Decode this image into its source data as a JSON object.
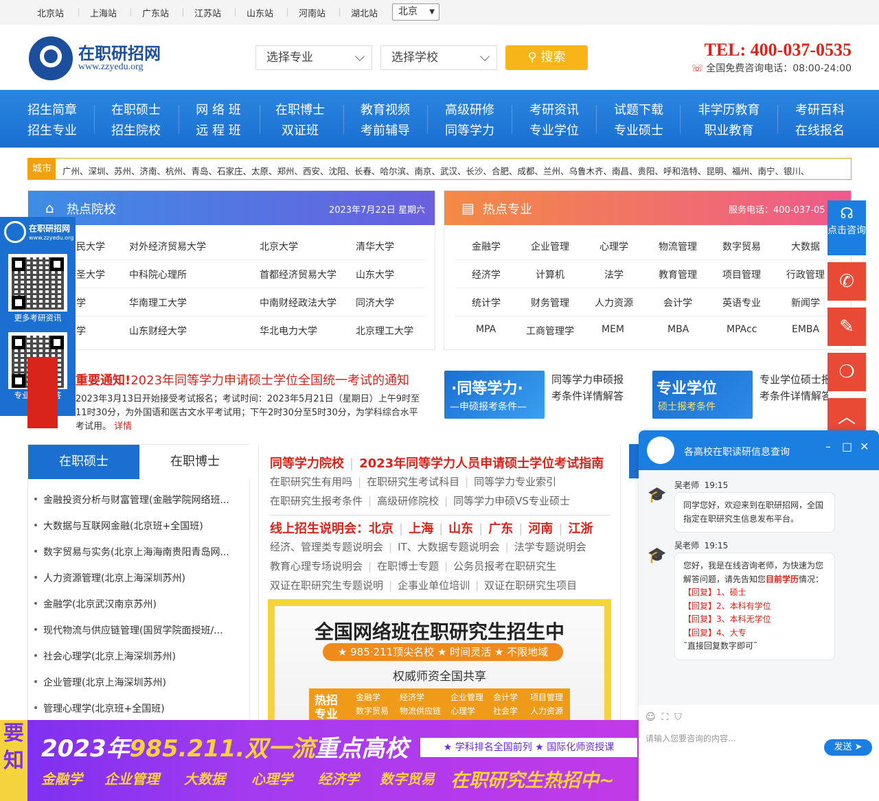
{
  "stations": [
    "北京站",
    "上海站",
    "广东站",
    "江苏站",
    "山东站",
    "河南站",
    "湖北站"
  ],
  "city_select": "北京",
  "logo": {
    "cn": "在职研招网",
    "en": "www.zzyedu.org"
  },
  "search": {
    "major": "选择专业",
    "school": "选择学校",
    "button": "搜索"
  },
  "contact": {
    "tel": "TEL: 400-037-0535",
    "hotline": "全国免费咨询电话：08:00-24:00"
  },
  "nav": [
    [
      "招生简章",
      "招生专业"
    ],
    [
      "在职硕士",
      "招生院校"
    ],
    [
      "网 络 班",
      "远 程 班"
    ],
    [
      "在职博士",
      "双证班"
    ],
    [
      "教育视频",
      "考前辅导"
    ],
    [
      "高级研修",
      "同等学力"
    ],
    [
      "考研资讯",
      "专业学位"
    ],
    [
      "试题下载",
      "专业硕士"
    ],
    [
      "非学历教育",
      "职业教育"
    ],
    [
      "考研百科",
      "在线报名"
    ]
  ],
  "cities": {
    "label": "城市",
    "list": "广州、深圳、苏州、济南、杭州、青岛、石家庄、太原、郑州、西安、沈阳、长春、哈尔滨、南京、武汉、长沙、合肥、成都、兰州、乌鲁木齐、南昌、贵阳、呼和浩特、昆明、福州、南宁、银川、"
  },
  "hot_schools": {
    "title": "热点院校",
    "date": "2023年7月22日 星期六",
    "rows": [
      [
        "民大学",
        "对外经济贸易大学",
        "北京大学",
        "清华大学"
      ],
      [
        "圣大学",
        "中科院心理所",
        "首都经济贸易大学",
        "山东大学"
      ],
      [
        "学",
        "华南理工大学",
        "中南财经政法大学",
        "同济大学"
      ],
      [
        "学",
        "山东财经大学",
        "华北电力大学",
        "北京理工大学"
      ]
    ]
  },
  "hot_majors": {
    "title": "热点专业",
    "service": "服务电话：400-037-05",
    "rows": [
      [
        "金融学",
        "企业管理",
        "心理学",
        "物流管理",
        "数字贸易",
        "大数据"
      ],
      [
        "经济学",
        "计算机",
        "法学",
        "教育管理",
        "项目管理",
        "行政管理"
      ],
      [
        "统计学",
        "财务管理",
        "人力资源",
        "会计学",
        "英语专业",
        "新闻学"
      ],
      [
        "MPA",
        "工商管理学",
        "MEM",
        "MBA",
        "MPAcc",
        "EMBA"
      ]
    ]
  },
  "qr": {
    "logo_cn": "在职研招网",
    "logo_en": "www.zzyedu.org",
    "cap1": "更多考研资讯",
    "cap2": "专业老师解答"
  },
  "notice": {
    "label": "重要通知!",
    "title": "2023年同等学力申请硕士学位全国统一考试的通知",
    "body": "2023年3月13日开始接受考试报名；考试时间：2023年5月21日（星期日）上午9时至11时30分，为外国语和医古文水平考试用；下午2时30分至5时30分，为学科综合水平考试用。",
    "more": "详情"
  },
  "promos": [
    {
      "a": "·同等学力·",
      "b": "—申硕报考条件—",
      "text": [
        "同等学力申硕报",
        "考条件详情解答"
      ]
    },
    {
      "a": "专业学位",
      "b": "硕士报考条件",
      "text": [
        "专业学位硕士报",
        "考条件详情解答"
      ]
    }
  ],
  "float_btn": {
    "consult": "点击咨询"
  },
  "tabs": {
    "a": "在职硕士",
    "b": "在职博士",
    "items": [
      "金融投资分析与财富管理(金融学院网络班...",
      "大数据与互联网金融(北京班+全国班)",
      "数字贸易与实务(北京上海海南贵阳青岛网...",
      "人力资源管理(北京上海深圳苏州)",
      "金融学(北京武汉南京苏州)",
      "现代物流与供应链管理(国贸学院面授班/...",
      "社会心理学(北京上海深圳苏州)",
      "企业管理(北京上海深圳苏州)",
      "管理心理学(北京班+全国班)"
    ]
  },
  "mid": {
    "h1": [
      "同等学力院校",
      "2023年同等学力人员申请硕士学位考试指南"
    ],
    "l1": [
      "在职研究生有用吗",
      "在职研究生考试科目",
      "同等学力专业索引"
    ],
    "l2": [
      "在职研究生报考条件",
      "高级研修院校",
      "同等学力申硕VS专业硕士"
    ],
    "h2": [
      "线上招生说明会：北京",
      "上海",
      "山东",
      "广东",
      "河南",
      "江浙"
    ],
    "l3": [
      "经济、管理类专题说明会",
      "IT、大数据专题说明会",
      "法学专题说明会"
    ],
    "l4": [
      "教育心理专场说明会",
      "在职博士专题",
      "公务员报考在职研究生"
    ],
    "l5": [
      "双证在职研究生专题说明",
      "企事业单位培训",
      "双证在职研究生项目"
    ]
  },
  "banner_net": {
    "title": "全国网络班在职研究生招生中",
    "pill": "★ 985·211顶尖名校 ★ 时间灵活 ★ 不限地域",
    "sub": "权威师资全国共享",
    "key": "热招专业",
    "majors": [
      "金融学",
      "经济学",
      "企业管理",
      "会计学",
      "项目管理",
      "数字贸易",
      "物流供应链",
      "心理学",
      "社会学",
      "人力资源"
    ]
  },
  "bottom": {
    "left": "要知",
    "t1a": "2023年",
    "t1b": "985.211.双一流",
    "t1c": "重点高校",
    "box": "★ 学科排名全国前列  ★ 国际化师资授课",
    "tags": [
      "金融学",
      "企业管理",
      "大数据",
      "心理学",
      "经济学",
      "数字贸易"
    ],
    "hot": "在职研究生热招中~"
  },
  "chat": {
    "title": "各高校在职读研信息查询",
    "m1": {
      "name": "吴老师",
      "time": "19:15",
      "text": "同学您好，欢迎来到在职研招网，全国指定在职研究生信息发布平台。"
    },
    "m2": {
      "name": "吴老师",
      "time": "19:15",
      "text1": "您好，我是在线咨询老师，为快速为您解答问题，请先告知您",
      "hl": "目前学历",
      "text2": "情况：",
      "opts": [
        "【回复】1、硕士",
        "【回复】2、本科有学位",
        "【回复】3、本科无学位",
        "【回复】4、大专"
      ],
      "tail": "˜直接回复数字即可˜"
    },
    "placeholder": "请输入您要咨询的内容...",
    "send": "发送"
  }
}
